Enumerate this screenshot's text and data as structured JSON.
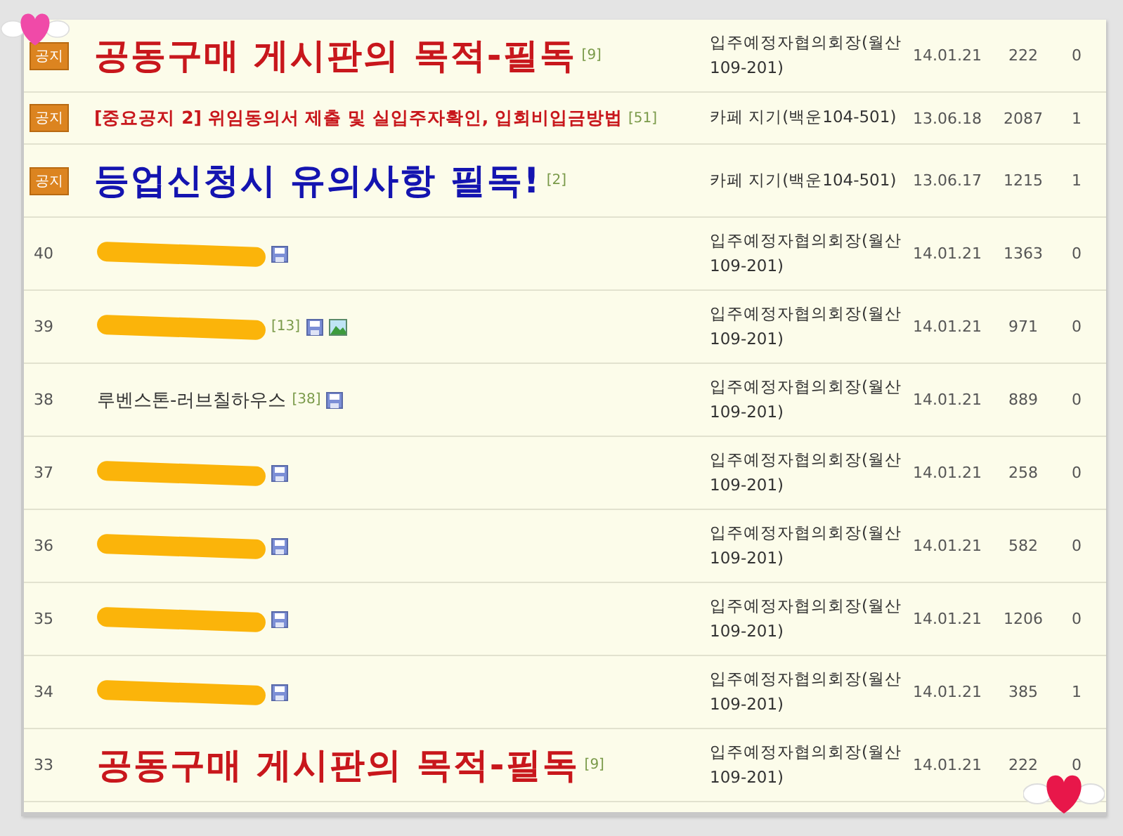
{
  "posts": [
    {
      "kind": "notice",
      "badge": "공지",
      "title": {
        "text": "공동구매 게시판의 목적-필독",
        "kind": "big-red"
      },
      "comments": "[9]",
      "author": "입주예정자협의회장(월산109-201)",
      "date": "14.01.21",
      "views": "222",
      "replies": "0"
    },
    {
      "kind": "notice",
      "badge": "공지",
      "title": {
        "text": "[중요공지 2] 위임동의서 제출 및 실입주자확인, 입회비입금방법",
        "kind": "bold-red"
      },
      "comments": "[51]",
      "author": "카페 지기(백운104-501)",
      "date": "13.06.18",
      "views": "2087",
      "replies": "1"
    },
    {
      "kind": "notice",
      "badge": "공지",
      "title": {
        "text": "등업신청시 유의사항 필독!",
        "kind": "big-blue"
      },
      "comments": "[2]",
      "author": "카페 지기(백운104-501)",
      "date": "13.06.17",
      "views": "1215",
      "replies": "1"
    },
    {
      "kind": "post",
      "number": "40",
      "redacted": true,
      "attachments": [
        {
          "kind": "file"
        }
      ],
      "author": "입주예정자협의회장(월산109-201)",
      "date": "14.01.21",
      "views": "1363",
      "replies": "0"
    },
    {
      "kind": "post",
      "number": "39",
      "redacted": true,
      "comments": "[13]",
      "attachments": [
        {
          "kind": "file"
        },
        {
          "kind": "image"
        }
      ],
      "author": "입주예정자협의회장(월산109-201)",
      "date": "14.01.21",
      "views": "971",
      "replies": "0"
    },
    {
      "kind": "post",
      "number": "38",
      "title": {
        "text": "루벤스톤-러브칠하우스",
        "kind": "normal"
      },
      "comments": "[38]",
      "attachments": [
        {
          "kind": "file"
        }
      ],
      "author": "입주예정자협의회장(월산109-201)",
      "date": "14.01.21",
      "views": "889",
      "replies": "0"
    },
    {
      "kind": "post",
      "number": "37",
      "redacted": true,
      "attachments": [
        {
          "kind": "file"
        }
      ],
      "author": "입주예정자협의회장(월산109-201)",
      "date": "14.01.21",
      "views": "258",
      "replies": "0"
    },
    {
      "kind": "post",
      "number": "36",
      "redacted": true,
      "attachments": [
        {
          "kind": "file"
        }
      ],
      "author": "입주예정자협의회장(월산109-201)",
      "date": "14.01.21",
      "views": "582",
      "replies": "0"
    },
    {
      "kind": "post",
      "number": "35",
      "redacted": true,
      "attachments": [
        {
          "kind": "file"
        }
      ],
      "author": "입주예정자협의회장(월산109-201)",
      "date": "14.01.21",
      "views": "1206",
      "replies": "0"
    },
    {
      "kind": "post",
      "number": "34",
      "redacted": true,
      "attachments": [
        {
          "kind": "file"
        }
      ],
      "author": "입주예정자협의회장(월산109-201)",
      "date": "14.01.21",
      "views": "385",
      "replies": "1"
    },
    {
      "kind": "post",
      "number": "33",
      "title": {
        "text": "공동구매 게시판의 목적-필독",
        "kind": "big-red"
      },
      "comments": "[9]",
      "author": "입주예정자협의회장(월산109-201)",
      "date": "14.01.21",
      "views": "222",
      "replies": "0"
    }
  ]
}
